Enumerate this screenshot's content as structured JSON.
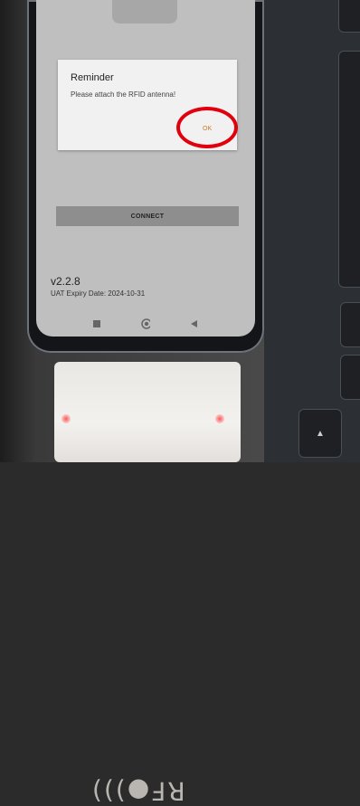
{
  "dialog": {
    "title": "Reminder",
    "message": "Please attach the RFID antenna!",
    "ok_label": "OK"
  },
  "main": {
    "connect_label": "CONNECT",
    "version": "v2.2.8",
    "expiry": "UAT Expiry Date:  2024-10-31"
  },
  "navbar": {
    "icons": [
      "recent-apps-icon",
      "home-icon",
      "back-icon"
    ]
  },
  "device": {
    "rfid_label": "RF●)))"
  },
  "colors": {
    "highlight": "#e0000e",
    "ok_text": "#c77a2a"
  }
}
